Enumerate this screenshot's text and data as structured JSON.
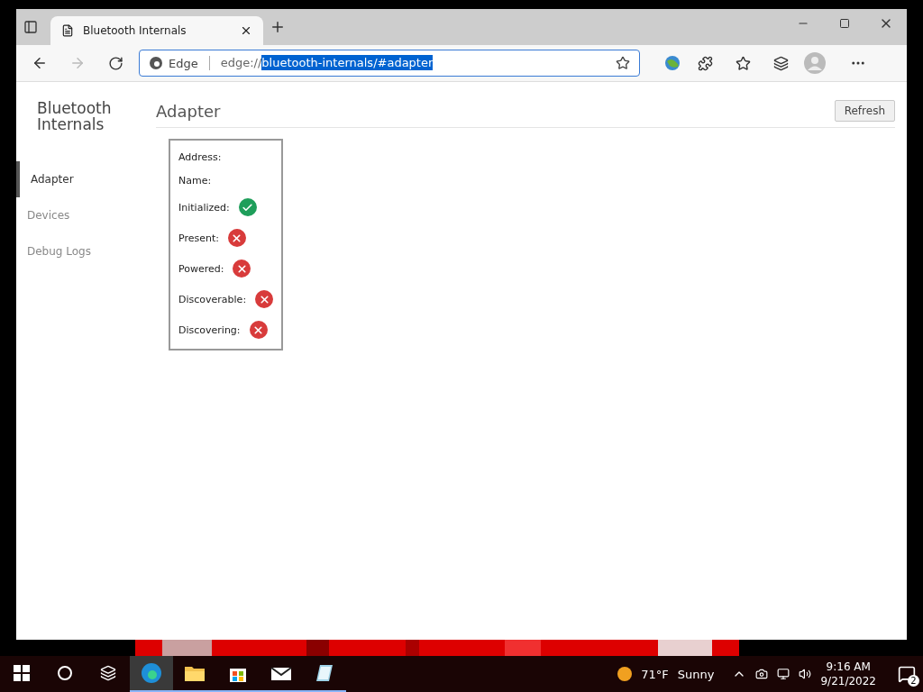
{
  "browser": {
    "tab_title": "Bluetooth Internals",
    "site_label": "Edge",
    "url_prefix": "edge://",
    "url_selected": "bluetooth-internals/#adapter"
  },
  "sidebar": {
    "title": "Bluetooth Internals",
    "items": [
      {
        "label": "Adapter",
        "selected": true
      },
      {
        "label": "Devices",
        "selected": false
      },
      {
        "label": "Debug Logs",
        "selected": false
      }
    ]
  },
  "page": {
    "title": "Adapter",
    "refresh_button": "Refresh",
    "fields": [
      {
        "label": "Address:",
        "kind": "text"
      },
      {
        "label": "Name:",
        "kind": "text"
      },
      {
        "label": "Initialized:",
        "kind": "status",
        "ok": true
      },
      {
        "label": "Present:",
        "kind": "status",
        "ok": false
      },
      {
        "label": "Powered:",
        "kind": "status",
        "ok": false
      },
      {
        "label": "Discoverable:",
        "kind": "status",
        "ok": false
      },
      {
        "label": "Discovering:",
        "kind": "status",
        "ok": false
      }
    ]
  },
  "taskbar": {
    "apps": [
      {
        "kind": "edge",
        "selected": true
      },
      {
        "kind": "explorer",
        "selected": false
      },
      {
        "kind": "store",
        "selected": false
      },
      {
        "kind": "mail",
        "selected": false
      },
      {
        "kind": "notes",
        "selected": false
      }
    ],
    "temperature": "71°F",
    "weather": "Sunny",
    "time": "9:16 AM",
    "date": "9/21/2022",
    "notifications": "2"
  }
}
